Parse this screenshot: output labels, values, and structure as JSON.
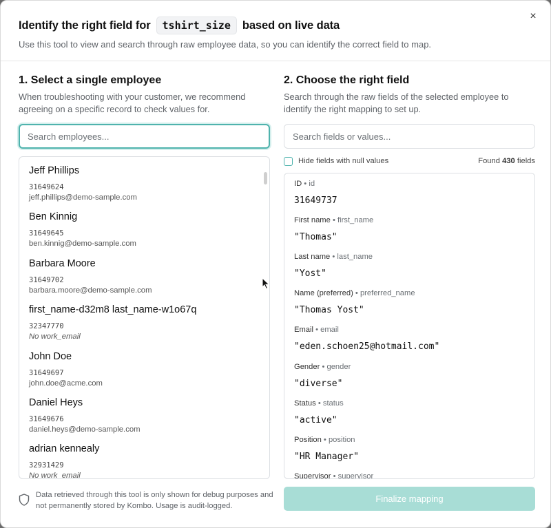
{
  "header": {
    "title_prefix": "Identify the right field for",
    "title_code": "tshirt_size",
    "title_suffix": "based on live data",
    "subtitle": "Use this tool to view and search through raw employee data, so you can identify the correct field to map.",
    "close_label": "×"
  },
  "left": {
    "title": "1. Select a single employee",
    "description": "When troubleshooting with your customer, we recommend agreeing on a specific record to check values for.",
    "search_placeholder": "Search employees...",
    "employees": [
      {
        "name": "Jeff Phillips",
        "id": "31649624",
        "email": "jeff.phillips@demo-sample.com"
      },
      {
        "name": "Ben Kinnig",
        "id": "31649645",
        "email": "ben.kinnig@demo-sample.com"
      },
      {
        "name": "Barbara Moore",
        "id": "31649702",
        "email": "barbara.moore@demo-sample.com"
      },
      {
        "name": "first_name-d32m8 last_name-w1o67q",
        "id": "32347770",
        "email": "No work_email"
      },
      {
        "name": "John Doe",
        "id": "31649697",
        "email": "john.doe@acme.com"
      },
      {
        "name": "Daniel Heys",
        "id": "31649676",
        "email": "daniel.heys@demo-sample.com"
      },
      {
        "name": "adrian kennealy",
        "id": "32931429",
        "email": "No work_email"
      }
    ],
    "footer_note": "Data retrieved through this tool is only shown for debug purposes and not permanently stored by Kombo. Usage is audit-logged."
  },
  "right": {
    "title": "2. Choose the right field",
    "description": "Search through the raw fields of the selected employee to identify the right mapping to set up.",
    "search_placeholder": "Search fields or values...",
    "hide_null_label": "Hide fields with null values",
    "found_prefix": "Found",
    "found_count": "430",
    "found_suffix": "fields",
    "fields": [
      {
        "label": "ID",
        "key": "id",
        "value": "31649737"
      },
      {
        "label": "First name",
        "key": "first_name",
        "value": "\"Thomas\""
      },
      {
        "label": "Last name",
        "key": "last_name",
        "value": "\"Yost\""
      },
      {
        "label": "Name (preferred)",
        "key": "preferred_name",
        "value": "\"Thomas Yost\""
      },
      {
        "label": "Email",
        "key": "email",
        "value": "\"eden.schoen25@hotmail.com\""
      },
      {
        "label": "Gender",
        "key": "gender",
        "value": "\"diverse\""
      },
      {
        "label": "Status",
        "key": "status",
        "value": "\"active\""
      },
      {
        "label": "Position",
        "key": "position",
        "value": "\"HR Manager\""
      },
      {
        "label": "Supervisor",
        "key": "supervisor",
        "value": ""
      }
    ],
    "separator": "•",
    "finalize_label": "Finalize mapping"
  },
  "colors": {
    "accent": "#4fb3ad",
    "button_disabled": "#a8ddd6"
  }
}
